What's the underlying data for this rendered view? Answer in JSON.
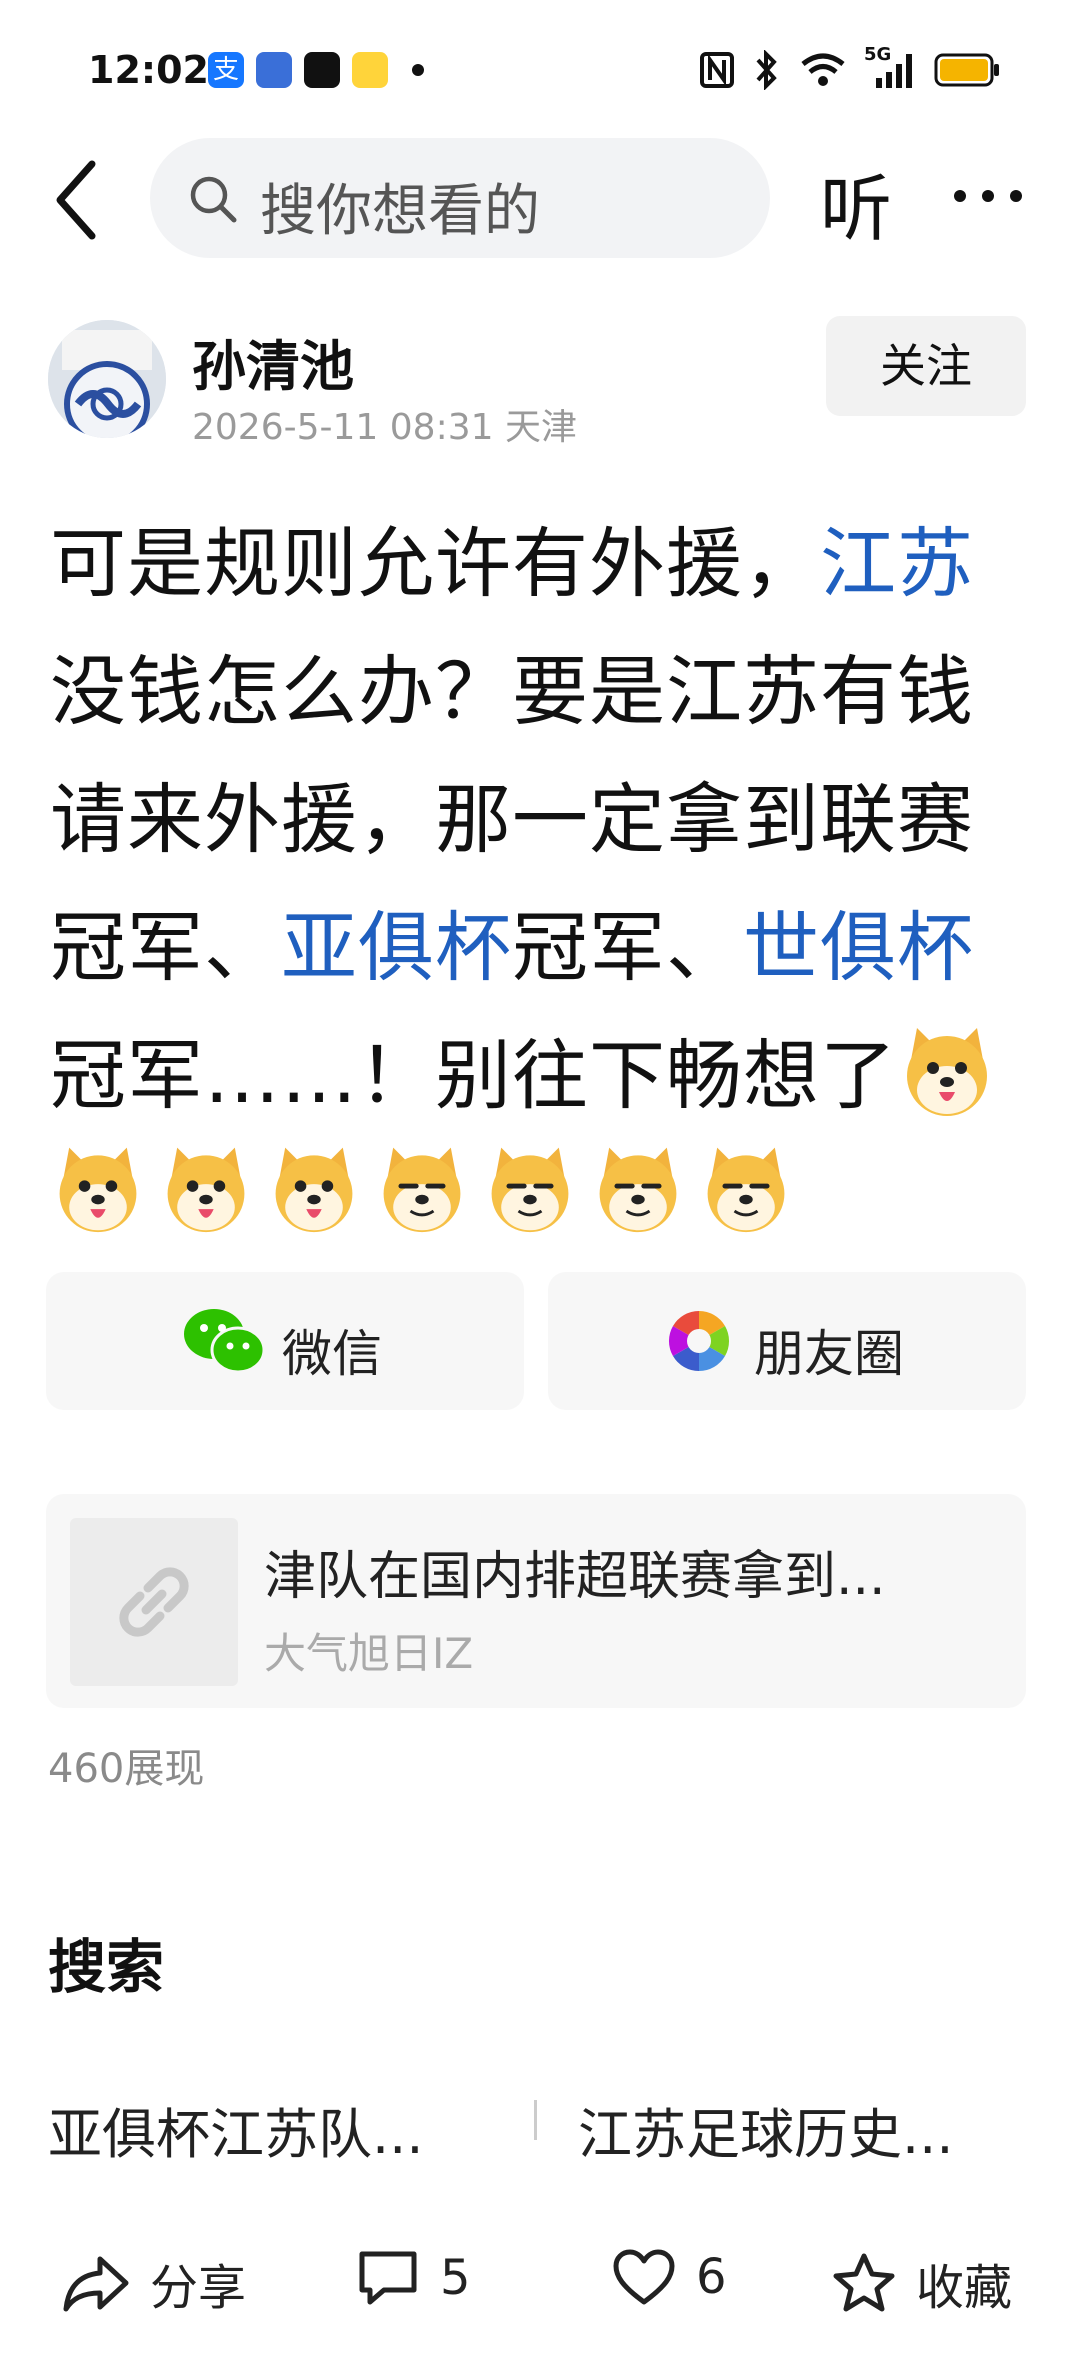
{
  "status_bar": {
    "time": "12:02",
    "network": "5G",
    "app_icons": [
      "alipay-icon",
      "app-icon",
      "douyin-icon",
      "weibo-icon"
    ]
  },
  "nav": {
    "search_placeholder": "搜你想看的",
    "listen_label": "听"
  },
  "author": {
    "name": "孙清池",
    "meta": "2026-5-11 08:31 天津",
    "follow_label": "关注"
  },
  "post": {
    "text_segments": [
      {
        "text": "可是规则允许有外援，",
        "link": false
      },
      {
        "text": "江苏",
        "link": true
      },
      {
        "text": "没钱怎么办？要是江苏有钱请来外援，那一定拿到联赛冠军、",
        "link": false
      },
      {
        "text": "亚俱杯",
        "link": true
      },
      {
        "text": "冠军、",
        "link": false
      },
      {
        "text": "世俱杯",
        "link": true
      },
      {
        "text": "冠军……！别往下畅想了",
        "link": false
      }
    ],
    "link_color": "#1f5fbf"
  },
  "share": {
    "wechat_label": "微信",
    "moments_label": "朋友圈"
  },
  "link_card": {
    "title": "津队在国内排超联赛拿到...",
    "source": "大气旭日IZ"
  },
  "views": "460展现",
  "search_section": {
    "heading": "搜索",
    "items": [
      "亚俱杯江苏队...",
      "江苏足球历史..."
    ]
  },
  "bottom_bar": {
    "share_label": "分享",
    "comments": "5",
    "likes": "6",
    "favorite_label": "收藏"
  }
}
